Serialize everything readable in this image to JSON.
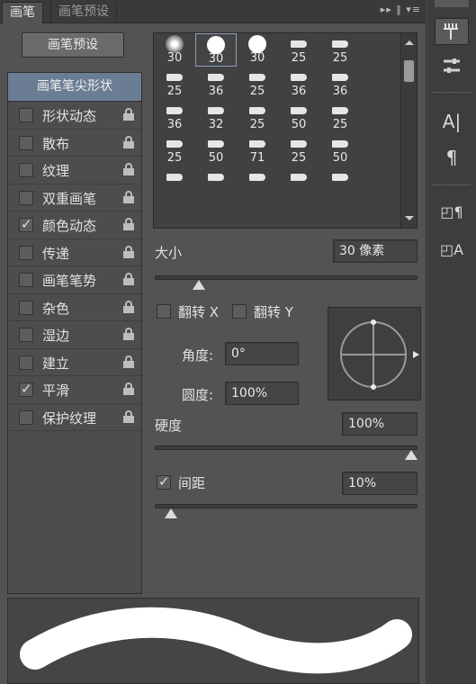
{
  "tabs": {
    "active": "画笔",
    "inactive": "画笔预设",
    "menu": "▸▸ ‖ ▾≡"
  },
  "preset_button": "画笔预设",
  "options": {
    "header": "画笔笔尖形状",
    "items": [
      {
        "label": "形状动态",
        "checked": false
      },
      {
        "label": "散布",
        "checked": false
      },
      {
        "label": "纹理",
        "checked": false
      },
      {
        "label": "双重画笔",
        "checked": false
      },
      {
        "label": "颜色动态",
        "checked": true
      },
      {
        "label": "传递",
        "checked": false
      },
      {
        "label": "画笔笔势",
        "checked": false
      },
      {
        "label": "杂色",
        "checked": false
      },
      {
        "label": "湿边",
        "checked": false
      },
      {
        "label": "建立",
        "checked": false
      },
      {
        "label": "平滑",
        "checked": true
      },
      {
        "label": "保护纹理",
        "checked": false
      }
    ]
  },
  "brushes": [
    {
      "size": "30",
      "icon": "soft-round"
    },
    {
      "size": "30",
      "icon": "hard-round",
      "selected": true
    },
    {
      "size": "30",
      "icon": "hard-round"
    },
    {
      "size": "25",
      "icon": "tip"
    },
    {
      "size": "25",
      "icon": "tip"
    },
    {
      "size": "25",
      "icon": "tip"
    },
    {
      "size": "36",
      "icon": "tip"
    },
    {
      "size": "25",
      "icon": "tip"
    },
    {
      "size": "36",
      "icon": "tip"
    },
    {
      "size": "36",
      "icon": "tip"
    },
    {
      "size": "36",
      "icon": "tip"
    },
    {
      "size": "32",
      "icon": "tip"
    },
    {
      "size": "25",
      "icon": "tip"
    },
    {
      "size": "50",
      "icon": "tip"
    },
    {
      "size": "25",
      "icon": "tip"
    },
    {
      "size": "25",
      "icon": "tip"
    },
    {
      "size": "50",
      "icon": "tip"
    },
    {
      "size": "71",
      "icon": "tip"
    },
    {
      "size": "25",
      "icon": "tip"
    },
    {
      "size": "50",
      "icon": "tip"
    },
    {
      "size": "",
      "icon": "tip"
    },
    {
      "size": "",
      "icon": "tip"
    },
    {
      "size": "",
      "icon": "tip"
    },
    {
      "size": "",
      "icon": "tip"
    },
    {
      "size": "",
      "icon": "tip"
    }
  ],
  "size": {
    "label": "大小",
    "value": "30 像素",
    "fraction": 0.15
  },
  "flip_x": {
    "label": "翻转 X",
    "checked": false
  },
  "flip_y": {
    "label": "翻转 Y",
    "checked": false
  },
  "angle": {
    "label": "角度:",
    "value": "0°"
  },
  "roundness": {
    "label": "圆度:",
    "value": "100%"
  },
  "hardness": {
    "label": "硬度",
    "value": "100%",
    "fraction": 1.0
  },
  "spacing": {
    "label": "间距",
    "value": "10%",
    "checked": true,
    "fraction": 0.04
  },
  "toolbar": {
    "tools": [
      "brush-tool-icon",
      "brush-settings-icon",
      "character-icon",
      "paragraph-icon",
      "paragraph-styles-icon",
      "character-styles-icon"
    ],
    "char_label": "A|",
    "para_label": "¶"
  },
  "colors": {
    "panel": "#535353",
    "header_selected": "#6b7d94",
    "preview_stroke": "#ffffff"
  }
}
